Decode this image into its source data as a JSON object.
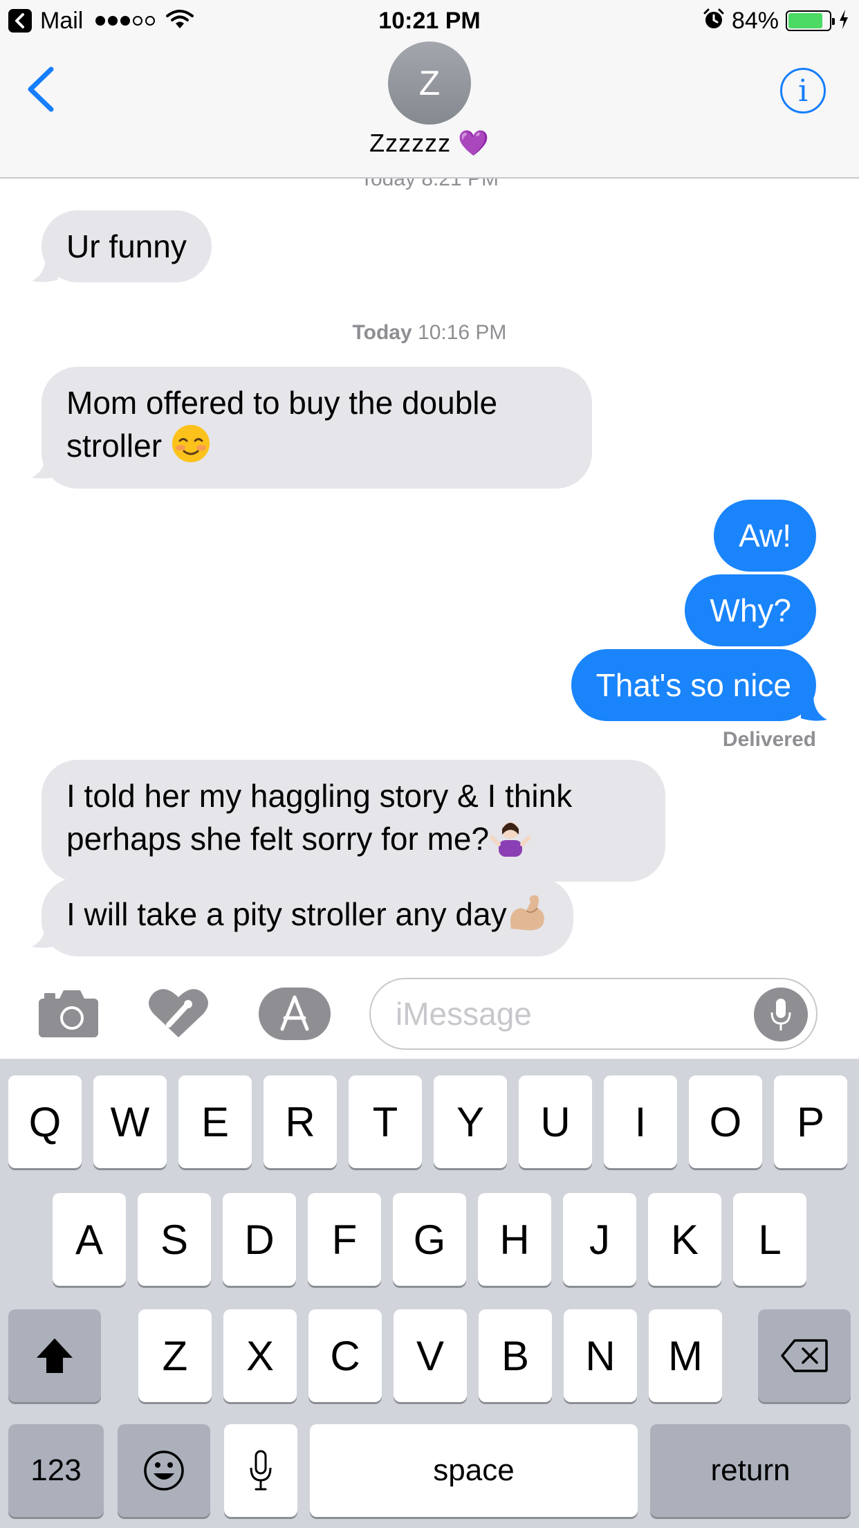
{
  "status_bar": {
    "back_app": "Mail",
    "time": "10:21 PM",
    "battery_percent": "84%",
    "battery_level": 0.84,
    "signal_bars_filled": 3,
    "signal_bars_total": 5
  },
  "header": {
    "avatar_initial": "Z",
    "contact_name": "Zzzzzz",
    "contact_emoji": "💜",
    "info_label": "i"
  },
  "conversation": {
    "top_timestamp_clipped": "Today 8:21 PM",
    "messages": [
      {
        "side": "in",
        "text": "Ur funny"
      },
      {
        "type": "timestamp",
        "day": "Today",
        "time": "10:16 PM"
      },
      {
        "side": "in",
        "line1": "Mom offered to buy the double",
        "line2": "stroller",
        "emoji": "☺️"
      },
      {
        "side": "out",
        "text": "Aw!"
      },
      {
        "side": "out",
        "text": "Why?"
      },
      {
        "side": "out",
        "text": "That's so nice"
      },
      {
        "side": "in",
        "line1": "I told her my haggling story & I think",
        "line2": "perhaps she felt sorry for me?",
        "emoji": "🤷🏻‍♀️"
      },
      {
        "side": "in",
        "text": "I will take a pity stroller any day",
        "emoji": "💪🏼"
      }
    ],
    "delivered_label": "Delivered"
  },
  "input_bar": {
    "icons": [
      "camera-icon",
      "digital-touch-icon",
      "app-store-icon",
      "microphone-icon"
    ],
    "placeholder": "iMessage",
    "value": ""
  },
  "keyboard": {
    "row1": [
      "Q",
      "W",
      "E",
      "R",
      "T",
      "Y",
      "U",
      "I",
      "O",
      "P"
    ],
    "row2": [
      "A",
      "S",
      "D",
      "F",
      "G",
      "H",
      "J",
      "K",
      "L"
    ],
    "row3": [
      "Z",
      "X",
      "C",
      "V",
      "B",
      "N",
      "M"
    ],
    "numbers_key": "123",
    "space_key": "space",
    "return_key": "return"
  },
  "colors": {
    "accent": "#157efb",
    "outgoing_bubble": "#1a84fb",
    "incoming_bubble": "#e5e5ea",
    "battery": "#4cd964",
    "keyboard_bg": "#d1d4da"
  }
}
